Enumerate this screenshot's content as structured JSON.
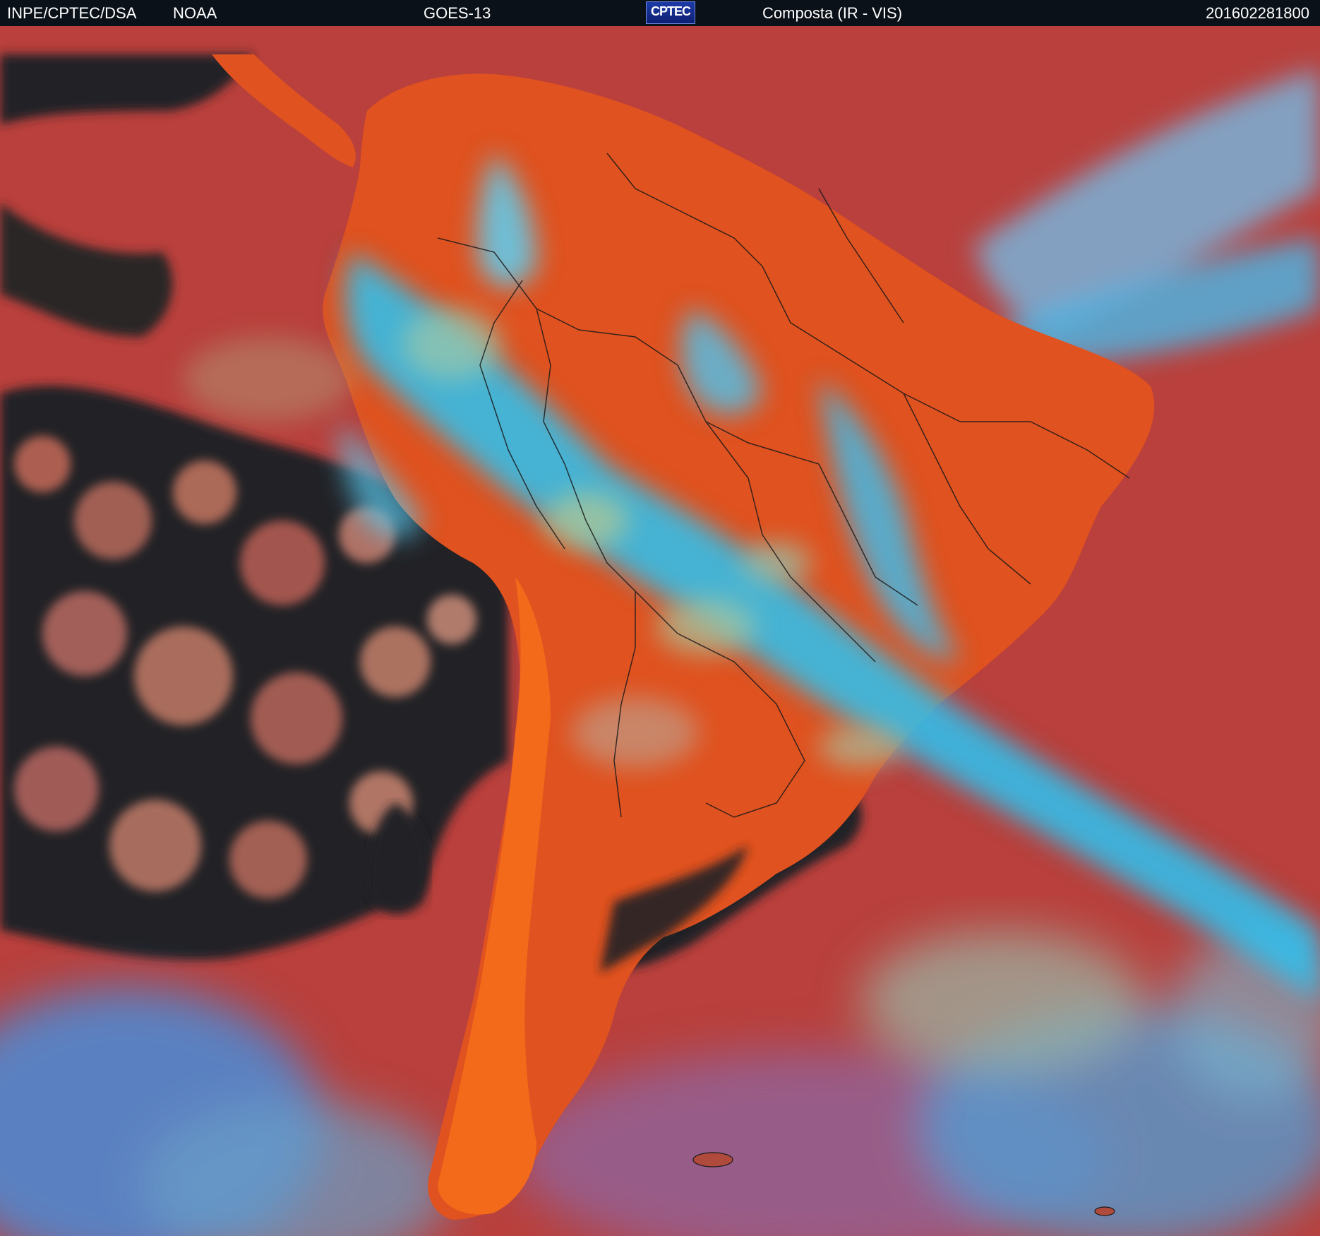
{
  "header": {
    "source": "INPE/CPTEC/DSA",
    "agency": "NOAA",
    "satellite": "GOES-13",
    "logo_text": "CPTEC",
    "product": "Composta (IR - VIS)",
    "timestamp": "201602281800"
  },
  "colors": {
    "header_bg": "#0b1118",
    "ocean_clear": "#b9403c",
    "land_clear": "#e0521f",
    "andes_land": "#f26a1a",
    "cloud_high": "#28c8ff",
    "cloud_mid": "#9fd08a",
    "cloud_low": "#6a88c8",
    "dark_cloud_free": "#232326",
    "border_lines": "#1a1a1a"
  },
  "map": {
    "region": "South America",
    "borders": "country and state boundaries drawn as thin dark lines"
  }
}
